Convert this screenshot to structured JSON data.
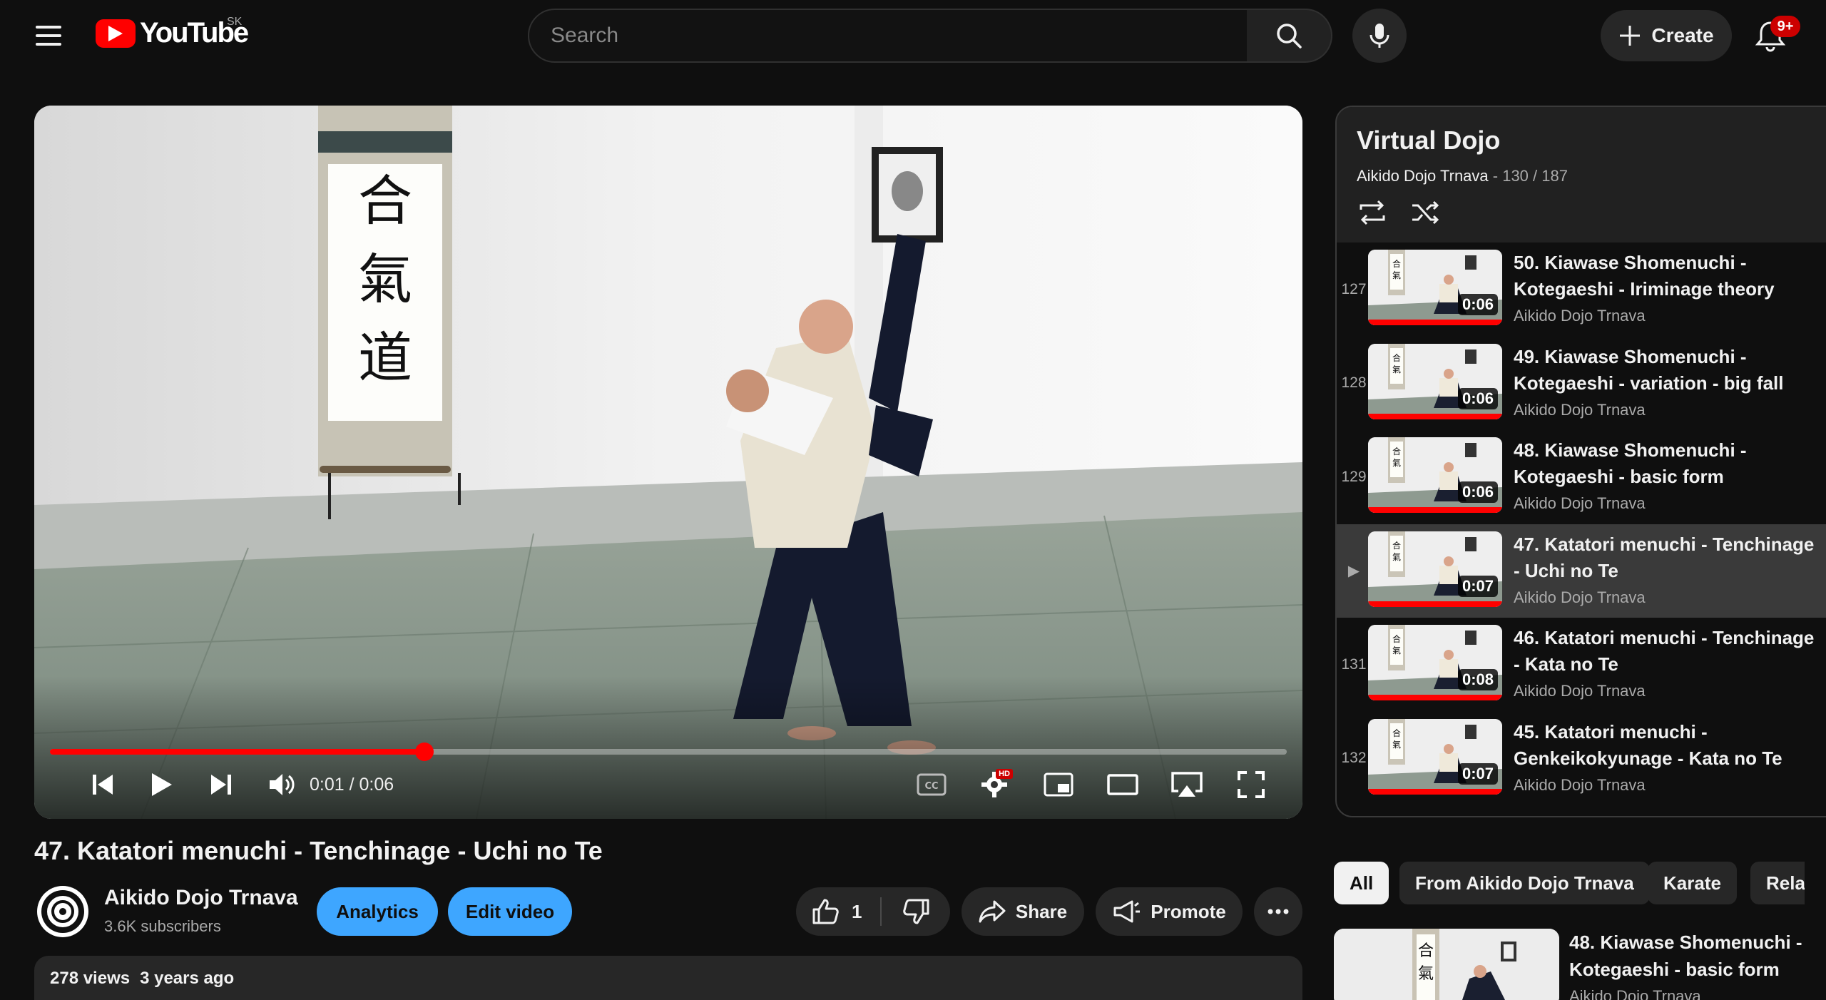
{
  "header": {
    "logo_text": "YouTube",
    "region": "SK",
    "search_placeholder": "Search",
    "create_label": "Create",
    "notifications_badge": "9+"
  },
  "player": {
    "time": "0:01 / 0:06",
    "progress_fraction": 0.303,
    "quality_badge": "HD"
  },
  "video": {
    "title": "47. Katatori menuchi - Tenchinage - Uchi no Te",
    "channel": "Aikido Dojo Trnava",
    "subscribers": "3.6K subscribers",
    "analytics_label": "Analytics",
    "edit_label": "Edit video",
    "likes": "1",
    "share_label": "Share",
    "promote_label": "Promote",
    "views": "278 views",
    "age": "3 years ago"
  },
  "playlist": {
    "title": "Virtual Dojo",
    "owner": "Aikido Dojo Trnava",
    "position": " - 130 / 187",
    "items": [
      {
        "index": "127",
        "title": "50. Kiawase Shomenuchi - Kotegaeshi - Iriminage theory",
        "channel": "Aikido Dojo Trnava",
        "duration": "0:06"
      },
      {
        "index": "128",
        "title": "49. Kiawase Shomenuchi - Kotegaeshi - variation - big fall",
        "channel": "Aikido Dojo Trnava",
        "duration": "0:06"
      },
      {
        "index": "129",
        "title": "48. Kiawase Shomenuchi - Kotegaeshi - basic form",
        "channel": "Aikido Dojo Trnava",
        "duration": "0:06"
      },
      {
        "index": "▶",
        "title": "47. Katatori menuchi - Tenchinage - Uchi no Te",
        "channel": "Aikido Dojo Trnava",
        "duration": "0:07"
      },
      {
        "index": "131",
        "title": "46. Katatori menuchi - Tenchinage - Kata no Te",
        "channel": "Aikido Dojo Trnava",
        "duration": "0:08"
      },
      {
        "index": "132",
        "title": "45. Katatori menuchi - Genkeikokyunage - Kata no Te",
        "channel": "Aikido Dojo Trnava",
        "duration": "0:07"
      }
    ]
  },
  "chips": [
    "All",
    "From Aikido Dojo Trnava",
    "Karate",
    "Relat"
  ],
  "recommendation": {
    "title": "48. Kiawase Shomenuchi - Kotegaeshi - basic form",
    "channel": "Aikido Dojo Trnava"
  },
  "colors": {
    "brand_red": "#ff0000",
    "accent_blue": "#3ea6ff",
    "background": "#0f0f0f"
  }
}
